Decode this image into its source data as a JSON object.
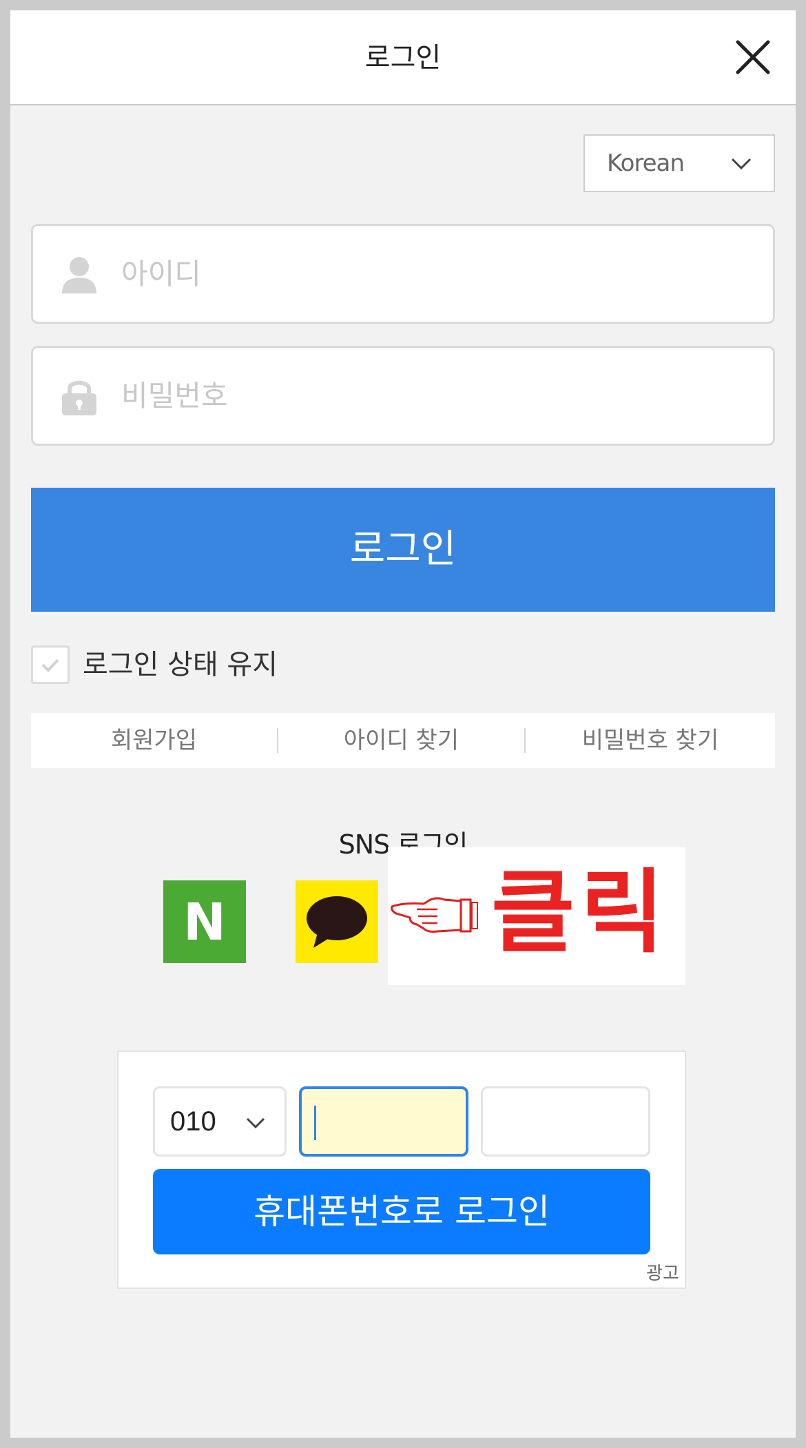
{
  "header": {
    "title": "로그인",
    "close_icon": "close-icon"
  },
  "language": {
    "selected": "Korean"
  },
  "form": {
    "id_placeholder": "아이디",
    "password_placeholder": "비밀번호",
    "login_label": "로그인",
    "keep_login_label": "로그인 상태 유지",
    "keep_login_checked": false
  },
  "links": [
    "회원가입",
    "아이디 찾기",
    "비밀번호 찾기"
  ],
  "sns": {
    "title": "SNS 로그인",
    "naver_letter": "N",
    "click_label": "클릭"
  },
  "phone_ad": {
    "prefix": "010",
    "login_label": "휴대폰번호로 로그인",
    "ad_label": "광고"
  },
  "colors": {
    "primary": "#3886e0",
    "naver": "#4aaa33",
    "kakao": "#ffe900",
    "click_red": "#ea2222",
    "phone_button": "#0b7bff"
  }
}
